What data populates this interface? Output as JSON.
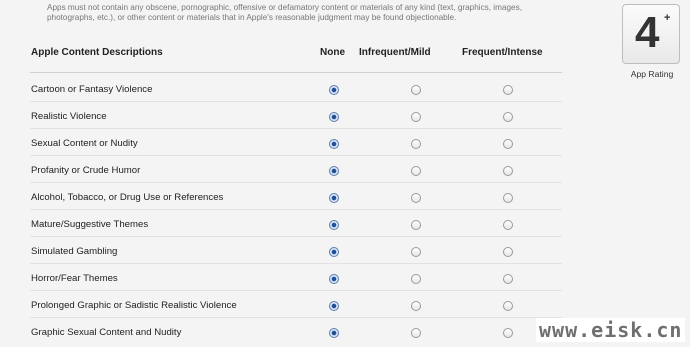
{
  "notice": "Apps must not contain any obscene, pornographic, offensive or defamatory content or materials of any kind (text, graphics, images, photographs, etc.), or other content or materials that in Apple's reasonable judgment may be found objectionable.",
  "header": {
    "title": "Apple Content Descriptions",
    "col_none": "None",
    "col_mild": "Infrequent/Mild",
    "col_intense": "Frequent/Intense"
  },
  "rows": [
    {
      "label": "Cartoon or Fantasy Violence",
      "selected": "none"
    },
    {
      "label": "Realistic Violence",
      "selected": "none"
    },
    {
      "label": "Sexual Content or Nudity",
      "selected": "none"
    },
    {
      "label": "Profanity or Crude Humor",
      "selected": "none"
    },
    {
      "label": "Alcohol, Tobacco, or Drug Use or References",
      "selected": "none"
    },
    {
      "label": "Mature/Suggestive Themes",
      "selected": "none"
    },
    {
      "label": "Simulated Gambling",
      "selected": "none"
    },
    {
      "label": "Horror/Fear Themes",
      "selected": "none"
    },
    {
      "label": "Prolonged Graphic or Sadistic Realistic Violence",
      "selected": "none"
    },
    {
      "label": "Graphic Sexual Content and Nudity",
      "selected": "none"
    }
  ],
  "rating": {
    "value": "4",
    "plus": "+",
    "caption": "App Rating"
  },
  "watermark": "www.eisk.cn"
}
